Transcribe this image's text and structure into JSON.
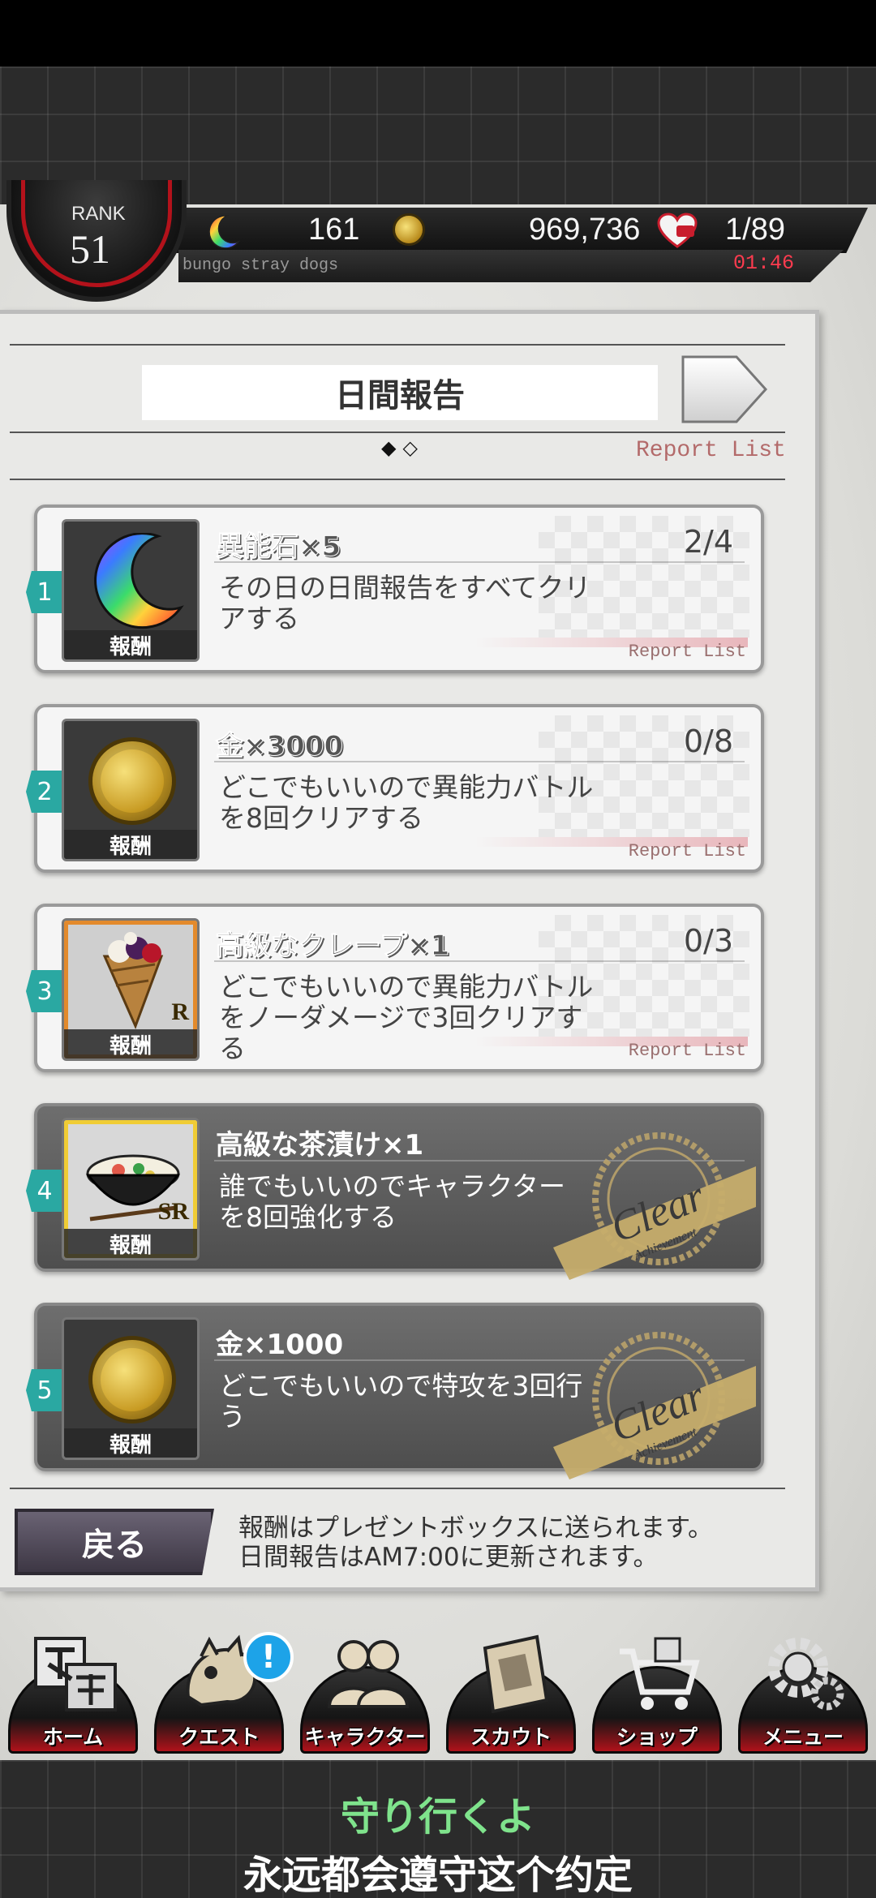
{
  "header": {
    "rank_label": "RANK",
    "rank_value": "51",
    "ability_stones": "161",
    "gold": "969,736",
    "ap": "1/89",
    "ap_timer": "01:46",
    "subtitle": "bungo stray dogs"
  },
  "panel": {
    "title": "日間報告",
    "page_dots": "◆◇",
    "report_list": "Report List"
  },
  "missions": [
    {
      "number": "1",
      "reward": "異能石×5",
      "progress": "2/4",
      "description": "その日の日間報告をすべてクリアする",
      "reward_label": "報酬",
      "report": "Report List",
      "state": "in-progress"
    },
    {
      "number": "2",
      "reward": "金×3000",
      "progress": "0/8",
      "description": "どこでもいいので異能力バトルを8回クリアする",
      "reward_label": "報酬",
      "report": "Report List",
      "state": "in-progress"
    },
    {
      "number": "3",
      "reward": "高級なクレープ×1",
      "progress": "0/3",
      "description": "どこでもいいので異能力バトルをノーダメージで3回クリアする",
      "reward_label": "報酬",
      "rarity": "R",
      "report": "Report List",
      "state": "in-progress"
    },
    {
      "number": "4",
      "reward": "高級な茶漬け×1",
      "description": "誰でもいいのでキャラクターを8回強化する",
      "reward_label": "報酬",
      "rarity": "SR",
      "stamp": "Clear",
      "stamp_sub": "Achievement",
      "state": "cleared"
    },
    {
      "number": "5",
      "reward": "金×1000",
      "description": "どこでもいいので特攻を3回行う",
      "reward_label": "報酬",
      "stamp": "Clear",
      "stamp_sub": "Achievement",
      "state": "cleared"
    }
  ],
  "footer": {
    "back_label": "戻る",
    "note_line1": "報酬はプレゼントボックスに送られます。",
    "note_line2": "日間報告はAM7:00に更新されます。"
  },
  "nav": [
    {
      "label": "ホーム",
      "icon": "home-bungo-icon"
    },
    {
      "label": "クエスト",
      "icon": "quest-icon",
      "alert": "!"
    },
    {
      "label": "キャラクター",
      "icon": "characters-icon"
    },
    {
      "label": "スカウト",
      "icon": "scout-book-icon"
    },
    {
      "label": "ショップ",
      "icon": "shop-cart-icon"
    },
    {
      "label": "メニュー",
      "icon": "menu-gear-icon"
    }
  ],
  "subtitles": {
    "jp": "守り行くよ",
    "cn": "永远都会遵守这个约定"
  },
  "colors": {
    "teal_badge": "#2aa8a2",
    "timer_red": "#ff3b4f",
    "subtitle_green": "#7fe38c"
  }
}
